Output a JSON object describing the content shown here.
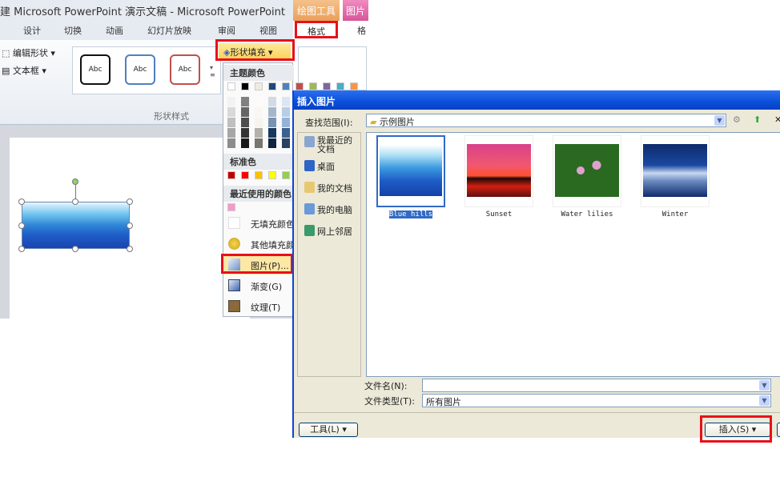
{
  "window": {
    "title": "建 Microsoft PowerPoint 演示文稿 - Microsoft PowerPoint",
    "ctx_drawing": "绘图工具",
    "ctx_picture": "图片"
  },
  "tabs": [
    "设计",
    "切换",
    "动画",
    "幻灯片放映",
    "审阅",
    "视图",
    "格式",
    "格"
  ],
  "ribbon": {
    "edit_shape": "编辑形状",
    "text_box": "文本框",
    "styles": [
      "Abc",
      "Abc",
      "Abc"
    ],
    "style_colors": [
      "#111111",
      "#4f81bd",
      "#c0504d"
    ],
    "group_label": "形状样式",
    "shape_fill": "形状填充"
  },
  "fill_menu": {
    "theme_colors_label": "主题颜色",
    "theme_colors": [
      "#ffffff",
      "#000000",
      "#eeece1",
      "#1f497d",
      "#4f81bd",
      "#c0504d",
      "#9bbb59",
      "#8064a2",
      "#4bacc6",
      "#f79646"
    ],
    "standard_label": "标准色",
    "standard_colors": [
      "#c00000",
      "#ff0000",
      "#ffc000",
      "#ffff00",
      "#92d050",
      "#00b050"
    ],
    "recent_label": "最近使用的颜色",
    "recent_colors": [
      "#f59ac8"
    ],
    "items": [
      {
        "label": "无填充颜色",
        "icon": "no-fill-icon"
      },
      {
        "label": "其他填充颜色...",
        "icon": "palette-icon"
      },
      {
        "label": "图片(P)...",
        "icon": "picture-icon"
      },
      {
        "label": "渐变(G)",
        "icon": "gradient-icon"
      },
      {
        "label": "纹理(T)",
        "icon": "texture-icon"
      }
    ]
  },
  "dialog": {
    "title": "插入图片",
    "look_in_label": "查找范围(I):",
    "look_in_value": "示例图片",
    "places": [
      "我最近的文档",
      "桌面",
      "我的文档",
      "我的电脑",
      "网上邻居"
    ],
    "files": [
      {
        "name": "Blue hills",
        "selected": true
      },
      {
        "name": "Sunset",
        "selected": false
      },
      {
        "name": "Water lilies",
        "selected": false
      },
      {
        "name": "Winter",
        "selected": false
      }
    ],
    "filename_label": "文件名(N):",
    "filename_value": "",
    "filetype_label": "文件类型(T):",
    "filetype_value": "所有图片",
    "tools_button": "工具(L)",
    "insert_button": "插入(S)"
  }
}
